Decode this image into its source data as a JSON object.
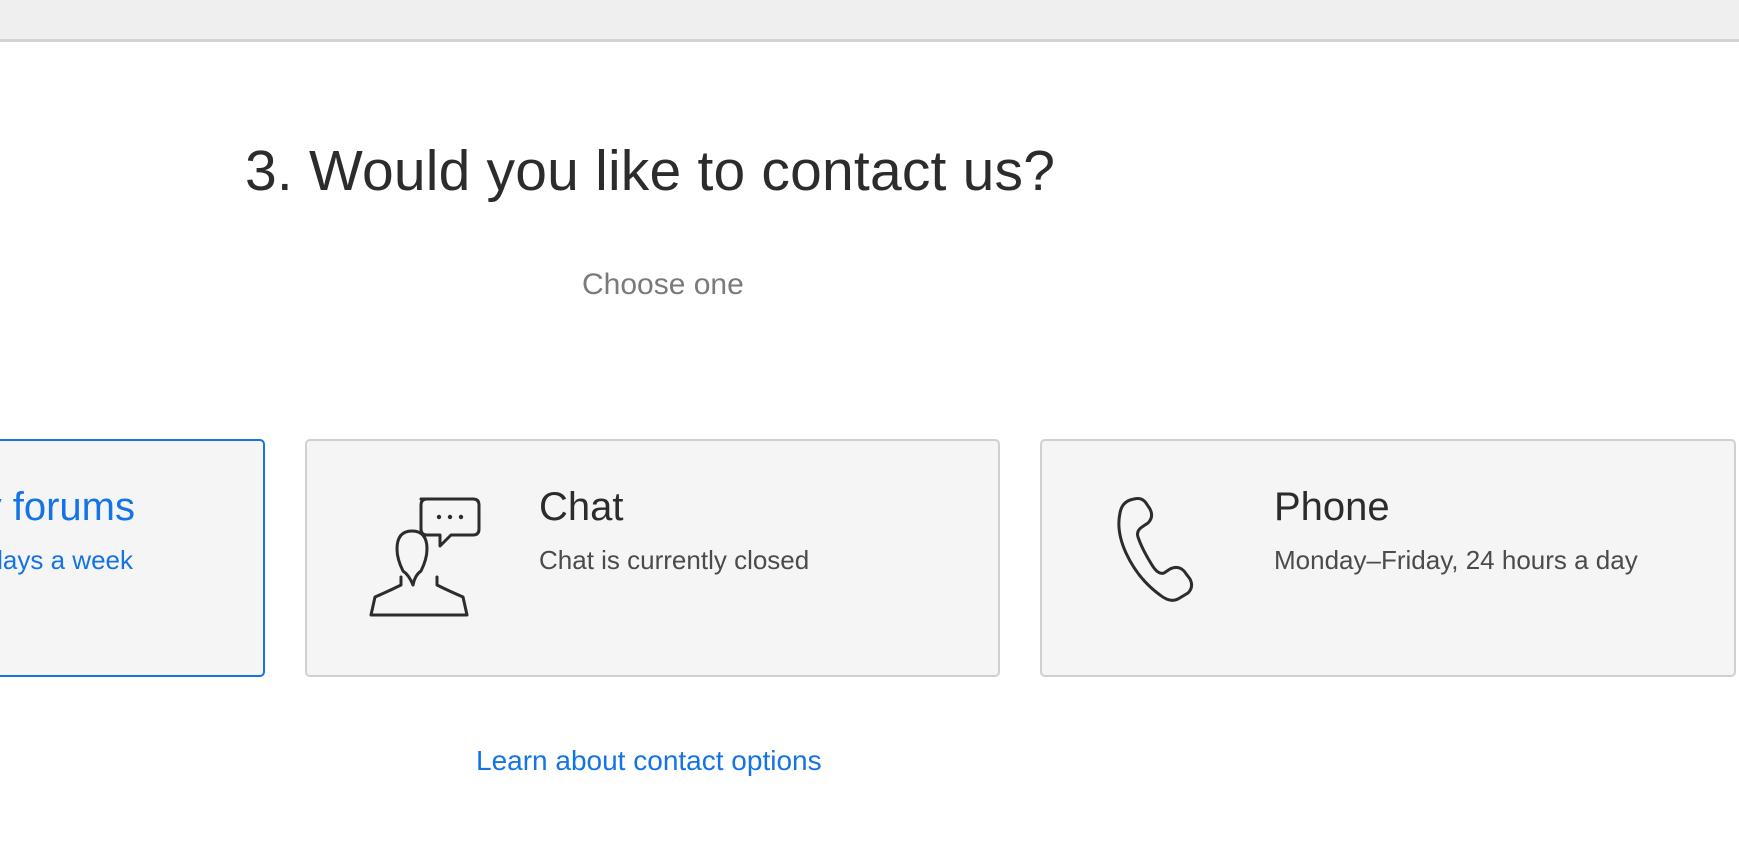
{
  "heading": "3. Would you like to contact us?",
  "subheading": "Choose one",
  "cards": {
    "forums": {
      "title": "y forums",
      "desc": "days a week",
      "selected": true
    },
    "chat": {
      "title": "Chat",
      "desc": "Chat is currently closed",
      "icon": "chat-person-icon"
    },
    "phone": {
      "title": "Phone",
      "desc": "Monday–Friday, 24 hours a day",
      "icon": "phone-icon"
    }
  },
  "learn_link": "Learn about contact options",
  "colors": {
    "accent": "#1473e6",
    "card_bg": "#f5f5f5",
    "card_border": "#d0d0d0",
    "text": "#2c2c2c",
    "muted": "#7a7a7a"
  }
}
